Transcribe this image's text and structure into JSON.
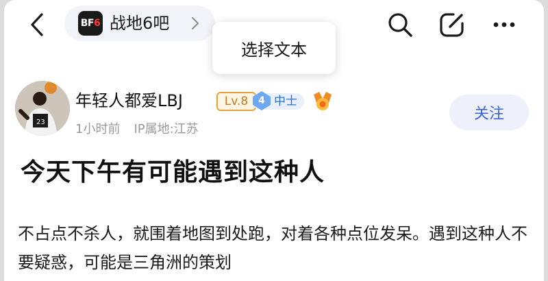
{
  "header": {
    "forum_logo_text": "BF",
    "forum_logo_accent": "6",
    "forum_name": "战地6吧",
    "popup_label": "选择文本"
  },
  "icons": {
    "back": "chevron-left-icon",
    "forum_more": "chevron-right-icon",
    "search": "search-icon",
    "edit": "edit-icon",
    "more": "more-horizontal-icon",
    "medal": "medal-icon"
  },
  "author": {
    "name": "年轻人都爱LBJ",
    "level_badge": "Lv.8",
    "rank_number": "4",
    "rank_label": "中士",
    "time": "1小时前",
    "ip_location": "IP属地:江苏",
    "follow_label": "关注"
  },
  "post": {
    "title": "今天下午有可能遇到这种人",
    "body": "不占点不杀人，就围着地图到处跑，对着各种点位发呆。遇到这种人不要疑惑，可能是三角洲的策划"
  },
  "colors": {
    "accent_blue": "#3b64d6",
    "level_orange": "#e3a23c",
    "meta_gray": "#9a9a9a",
    "follow_bg": "#eef1fb"
  }
}
